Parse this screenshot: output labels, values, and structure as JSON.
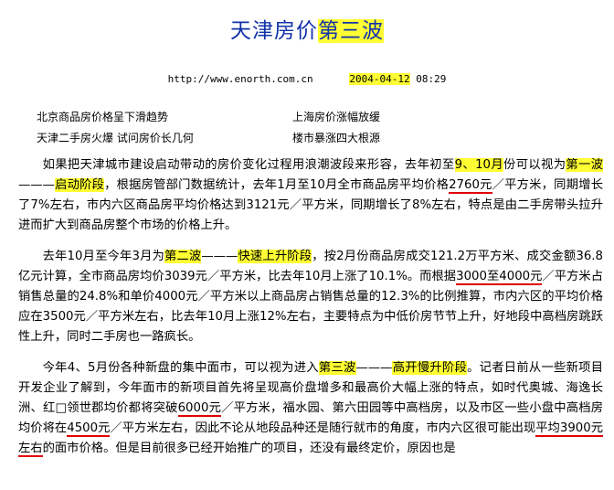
{
  "title": {
    "prefix": "天津房价",
    "highlight": "第三波"
  },
  "meta": {
    "url": "http://www.enorth.com.cn",
    "date": "2004-04-12",
    "time": "08:29"
  },
  "related_links": [
    "北京商品房价格呈下滑趋势",
    "上海房价涨幅放缓",
    "天津二手房火爆 试问房价长几何",
    "楼市暴涨四大根源"
  ],
  "paragraphs": {
    "p1": {
      "t1": "如果把天津城市建设启动带动的房价变化过程用浪潮波段来形容，去年初至",
      "h1": "9、10月",
      "t2": "份可以视为",
      "h2": "第一波",
      "t3": "———",
      "h3": "启动阶段",
      "t4": "，根据房管部门数据统计，去年1月至10月全市商品房平均价格",
      "u1": "2760元",
      "t5": "／平方米，同期增长了7%左右，市内六区商品房平均价格达到3121元／平方米，同期增长了8%左右，特点是由二手房带头拉升进而扩大到商品房整个市场的价格上升。"
    },
    "p2": {
      "t1": "去年10月至今年3月为",
      "h1": "第二波",
      "t2": "———",
      "h2": "快速上升阶段",
      "t3": "，按2月份商品房成交121.2万平方米、成交金额36.8亿元计算，全市商品房均价3039元／平方米，比去年10月上涨了10.1%。而根据",
      "u1": "3000至4000元",
      "t4": "／平方米占销售总量的24.8%和单价4000元／平方米以上商品房占销售总量的12.3%的比例推算，市内六区的平均价格应在3500元／平方米左右，比去年10月上涨12%左右，主要特点为中低价房节节上升，好地段中高档房跳跃性上升，同时二手房也一路疯长。"
    },
    "p3": {
      "t1": "今年4、5月份各种新盘的集中面市，可以视为进入",
      "h1": "第三波",
      "t2": "———",
      "h2": "高开慢升阶段",
      "t3": "。记者日前从一些新项目开发企业了解到，今年面市的新项目首先将呈现高价盘增多和最高价大幅上涨的特点，如时代奥城、海逸长洲、红□领世郡均价都将突破",
      "u1": "6000元",
      "t4": "／平方米，福水园、第六田园等中高档房，以及市区一些小盘中高档房均价将在",
      "u2": "4500元",
      "t5": "／平方米左右，因此不论从地段品种还是随行就市的角度，市内六区很可能出现",
      "u3": "平均3900元左右",
      "t6": "的面市价格。但是目前很多已经开始推广的项目，还没有最终定价，原因也是"
    }
  },
  "colors": {
    "highlight": "#ffff33",
    "underline": "#e00000",
    "title": "#1133aa"
  }
}
